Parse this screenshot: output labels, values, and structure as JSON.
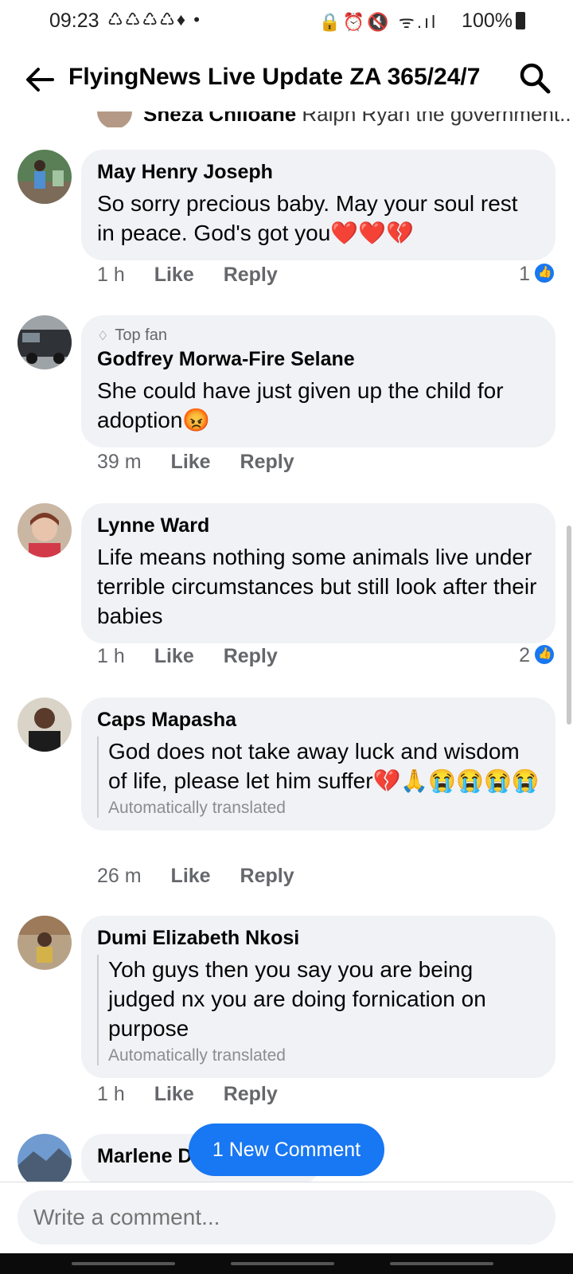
{
  "status_bar": {
    "time": "09:23",
    "notification_icons": "♺♺♺♺♦ •",
    "system_icons": "🔒⏰🔇 ᯤ.ıl",
    "battery": "100%"
  },
  "header": {
    "title": "FlyingNews Live Update ZA 365/24/7"
  },
  "clipped_reply": {
    "author": "Sheza Chiloane",
    "text": "Ralph Ryan the government..."
  },
  "comments": [
    {
      "author": "May Henry Joseph",
      "text": "So sorry precious baby. May your soul rest in peace.  God's got you❤️❤️💔",
      "age": "1 h",
      "like_label": "Like",
      "reply_label": "Reply",
      "like_count": "1"
    },
    {
      "badge": "Top fan",
      "author": "Godfrey Morwa-Fire Selane",
      "text": "She could have just given up the child for adoption😡",
      "age": "39 m",
      "like_label": "Like",
      "reply_label": "Reply"
    },
    {
      "author": "Lynne Ward",
      "text": "Life means nothing some animals live under terrible circumstances but still look after their babies",
      "age": "1 h",
      "like_label": "Like",
      "reply_label": "Reply",
      "like_count": "2"
    },
    {
      "author": "Caps Mapasha",
      "text": "God does not take away luck and wisdom of life, please let him suffer💔🙏😭😭😭😭",
      "translated_note": "Automatically translated",
      "age": "26 m",
      "like_label": "Like",
      "reply_label": "Reply"
    },
    {
      "author": "Dumi Elizabeth Nkosi",
      "text": "Yoh guys then you say you are being judged nx you are doing fornication on purpose",
      "translated_note": "Automatically translated",
      "age": "1 h",
      "like_label": "Like",
      "reply_label": "Reply"
    },
    {
      "author": "Marlene Dilger"
    }
  ],
  "new_comment_pill": "1 New Comment",
  "composer": {
    "placeholder": "Write a comment..."
  },
  "colors": {
    "accent": "#1877f2",
    "bubble": "#f0f2f5",
    "meta_text": "#65676b"
  }
}
